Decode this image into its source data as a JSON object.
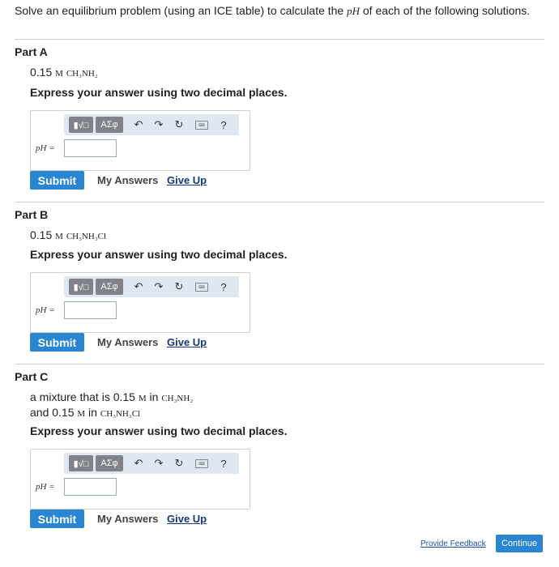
{
  "intro": {
    "text_before": "Solve an equilibrium problem (using an ICE table) to calculate the ",
    "var": "pH",
    "text_after": " of each of the following solutions."
  },
  "toolbar": {
    "template_label": "▮√□",
    "symbols_label": "ΑΣφ",
    "undo": "↶",
    "redo": "↷",
    "reset": "↻",
    "keyboard": "⌨",
    "help": "?"
  },
  "answer_label": "pH =",
  "submit_label": "Submit",
  "my_answers_label": "My Answers",
  "give_up_label": "Give Up",
  "instruction": "Express your answer using two decimal places.",
  "parts": [
    {
      "title": "Part A",
      "q_num": "0.15",
      "q_unit": "M",
      "q_formula": "CH₃NH₂"
    },
    {
      "title": "Part B",
      "q_num": "0.15",
      "q_unit": "M",
      "q_formula": "CH₃NH₃Cl"
    },
    {
      "title": "Part C",
      "q_line1_text": "a mixture that is ",
      "q_line1_num": "0.15",
      "q_line1_unit": "M",
      "q_line1_in": " in ",
      "q_line1_formula": "CH₃NH₂",
      "q_line2_text": "and ",
      "q_line2_num": "0.15",
      "q_line2_unit": "M",
      "q_line2_in": " in ",
      "q_line2_formula": "CH₃NH₃Cl"
    }
  ],
  "footer": {
    "feedback": "Provide Feedback",
    "continue": "Continue"
  }
}
